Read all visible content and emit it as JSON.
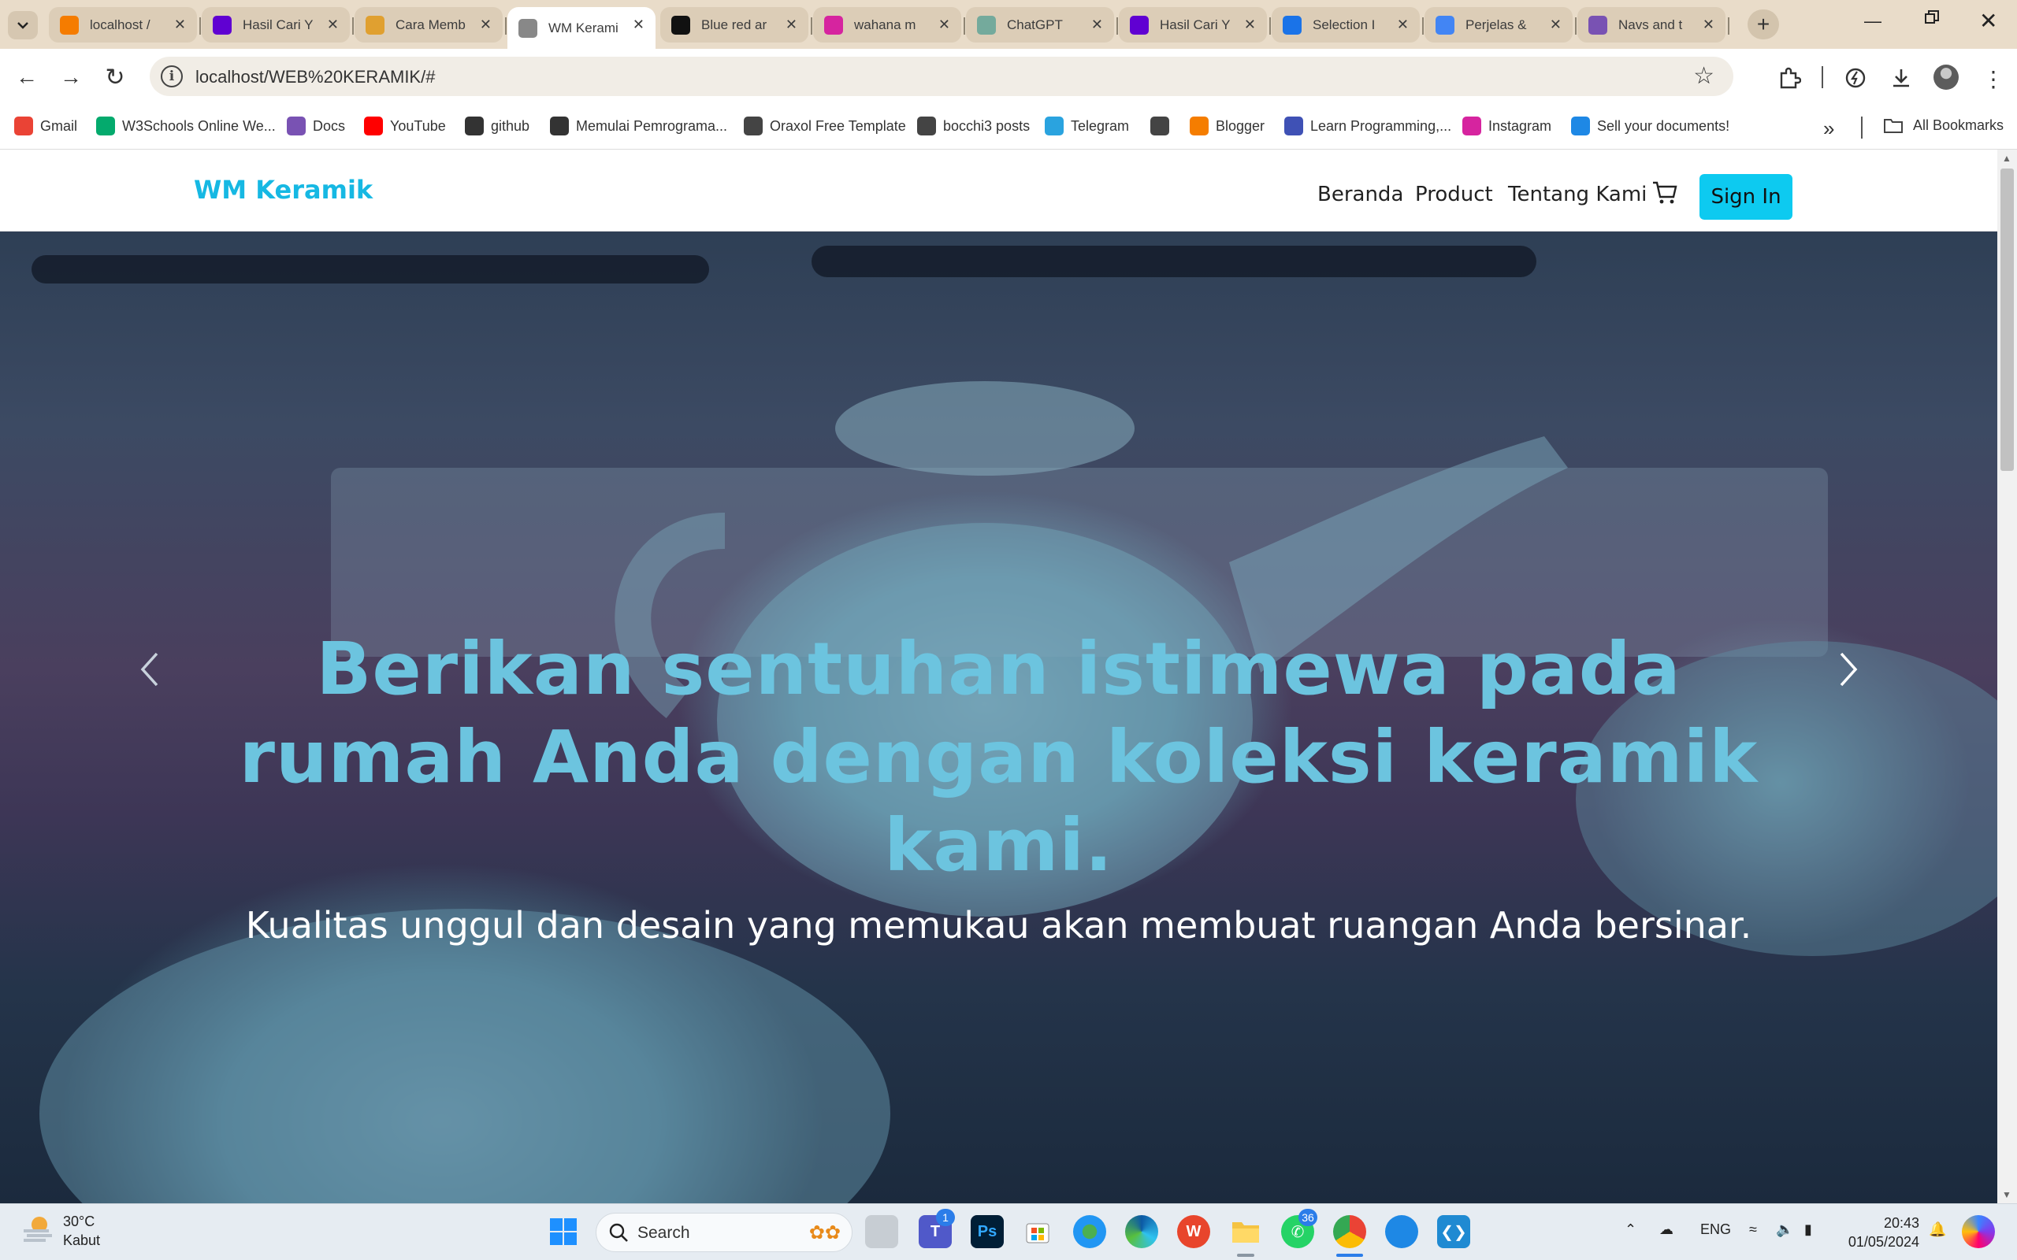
{
  "browser": {
    "tabs": [
      {
        "title": "localhost /",
        "icon": "xampp-icon",
        "color": "#f57c00"
      },
      {
        "title": "Hasil Cari Y",
        "icon": "yahoo-icon",
        "color": "#6001d2"
      },
      {
        "title": "Cara Memb",
        "icon": "web-favicon-icon",
        "color": "#e0a030"
      },
      {
        "title": "WM Kerami",
        "icon": "globe-icon",
        "color": "#888888",
        "active": true
      },
      {
        "title": "Blue red ar",
        "icon": "web-favicon-icon",
        "color": "#111111"
      },
      {
        "title": "wahana m",
        "icon": "instagram-icon",
        "color": "#d6249f"
      },
      {
        "title": "ChatGPT",
        "icon": "chatgpt-icon",
        "color": "#74aa9c"
      },
      {
        "title": "Hasil Cari Y",
        "icon": "yahoo-icon",
        "color": "#6001d2"
      },
      {
        "title": "Selection I",
        "icon": "web-favicon-icon",
        "color": "#1a73e8"
      },
      {
        "title": "Perjelas &",
        "icon": "web-favicon-icon",
        "color": "#4285f4"
      },
      {
        "title": "Navs and t",
        "icon": "bootstrap-icon",
        "color": "#7952b3"
      }
    ],
    "url": "localhost/WEB%20KERAMIK/#",
    "bookmarks": [
      {
        "label": "Gmail",
        "icon": "gmail-icon",
        "color": "#ea4335"
      },
      {
        "label": "W3Schools Online We...",
        "icon": "w3schools-icon",
        "color": "#04aa6d"
      },
      {
        "label": "Docs",
        "icon": "bootstrap-icon",
        "color": "#7952b3"
      },
      {
        "label": "YouTube",
        "icon": "youtube-icon",
        "color": "#ff0000"
      },
      {
        "label": "github",
        "icon": "github-icon",
        "color": "#333333"
      },
      {
        "label": "Memulai Pemrograma...",
        "icon": "web-favicon-icon",
        "color": "#333333"
      },
      {
        "label": "Oraxol Free Template",
        "icon": "globe-icon",
        "color": "#444444"
      },
      {
        "label": "bocchi3 posts",
        "icon": "globe-icon",
        "color": "#444444"
      },
      {
        "label": "Telegram",
        "icon": "telegram-icon",
        "color": "#2aa3df"
      },
      {
        "label": "",
        "icon": "globe-icon",
        "color": "#444444"
      },
      {
        "label": "Blogger",
        "icon": "blogger-icon",
        "color": "#f57d00"
      },
      {
        "label": "Learn Programming,...",
        "icon": "web-favicon-icon",
        "color": "#3f51b5"
      },
      {
        "label": "Instagram",
        "icon": "instagram-icon",
        "color": "#d6249f"
      },
      {
        "label": "Sell your documents!",
        "icon": "web-favicon-icon",
        "color": "#1e88e5"
      }
    ],
    "all_bookmarks_label": "All Bookmarks"
  },
  "site": {
    "brand": "WM Keramik",
    "brand_color": "#16b8e3",
    "nav": [
      "Beranda",
      "Product",
      "Tentang Kami"
    ],
    "signin_label": "Sign In",
    "signin_color": "#0dcaf0",
    "hero": {
      "title": "Berikan sentuhan istimewa pada rumah Anda dengan koleksi keramik kami.",
      "subtitle": "Kualitas unggul dan desain yang memukau akan membuat ruangan Anda bersinar.",
      "title_color": "#6cc4df"
    }
  },
  "taskbar": {
    "weather_temp": "30°C",
    "weather_desc": "Kabut",
    "search_label": "Search",
    "teams_badge": "1",
    "whatsapp_badge": "36",
    "language": "ENG",
    "time": "20:43",
    "date": "01/05/2024"
  }
}
